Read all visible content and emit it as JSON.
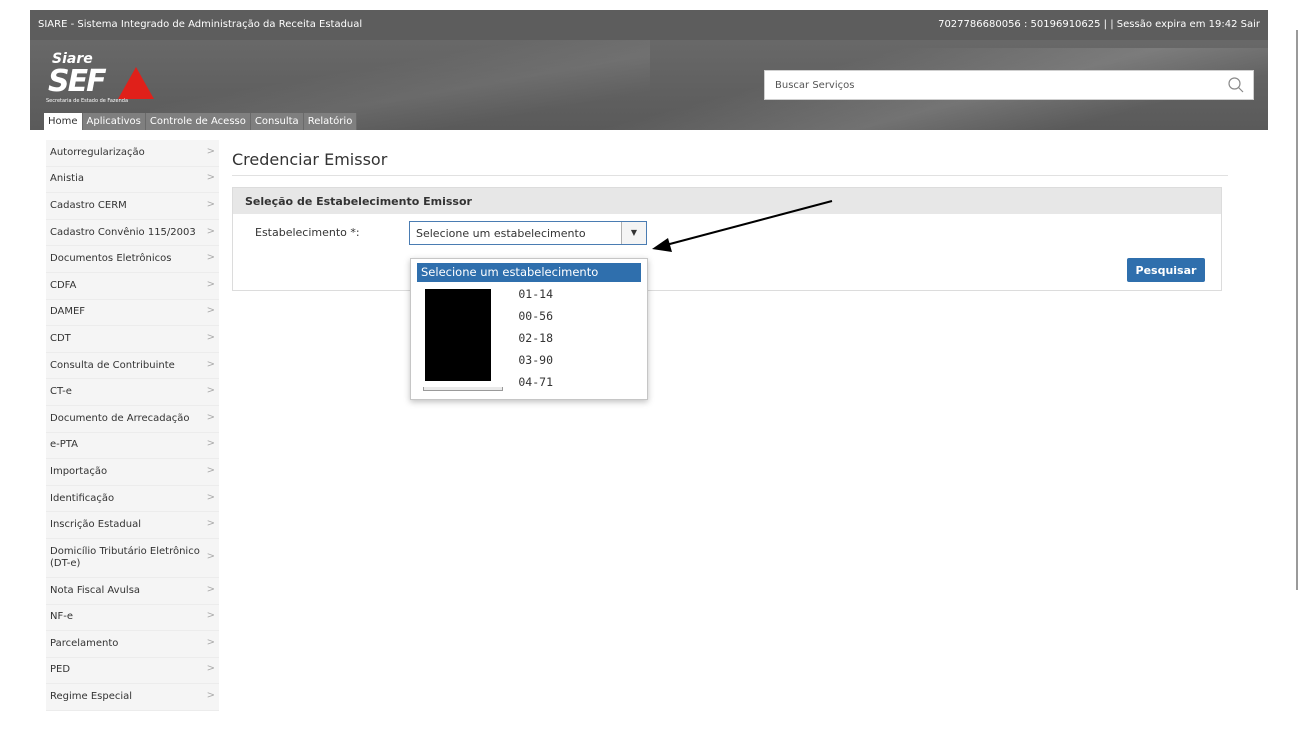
{
  "app": {
    "title": "SIARE - Sistema Integrado de Administração da Receita Estadual",
    "session": "7027786680056 : 50196910625 | | Sessão expira em 19:42 Sair"
  },
  "logo": {
    "siare": "Siare",
    "sef": "SEF",
    "subtitle": "Secretaria de Estado de Fazenda"
  },
  "search": {
    "placeholder": "Buscar Serviços",
    "icon": "search-icon"
  },
  "menu": [
    "Home",
    "Aplicativos",
    "Controle de Acesso",
    "Consulta",
    "Relatório"
  ],
  "sidebar": [
    "Autorregularização",
    "Anistia",
    "Cadastro CERM",
    "Cadastro Convênio 115/2003",
    "Documentos Eletrônicos",
    "CDFA",
    "DAMEF",
    "CDT",
    "Consulta de Contribuinte",
    "CT-e",
    "Documento de Arrecadação",
    "e-PTA",
    "Importação",
    "Identificação",
    "Inscrição Estadual",
    "Domicílio Tributário Eletrônico (DT-e)",
    "Nota Fiscal Avulsa",
    "NF-e",
    "Parcelamento",
    "PED",
    "Regime Especial"
  ],
  "main": {
    "title": "Credenciar Emissor",
    "panel_title": "Seleção de Estabelecimento Emissor",
    "field_label": "Estabelecimento *:",
    "select_value": "Selecione um estabelecimento",
    "search_button": "Pesquisar"
  },
  "dropdown": {
    "selected": "Selecione um estabelecimento",
    "options": [
      "01-14",
      "00-56",
      "02-18",
      "03-90",
      "04-71"
    ]
  },
  "colors": {
    "accent": "#2f6fad",
    "header": "#5d5d5d",
    "logo_red": "#e0201a"
  }
}
